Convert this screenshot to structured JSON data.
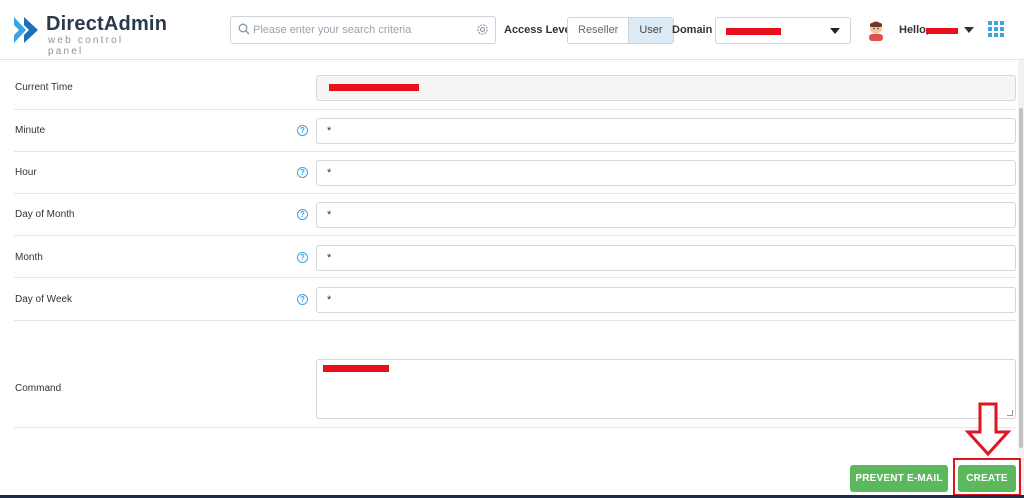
{
  "header": {
    "logo_title": "DirectAdmin",
    "logo_subtitle": "web control panel",
    "search_placeholder": "Please enter your search criteria",
    "access_level_label": "Access Level",
    "access_levels": [
      "Reseller",
      "User"
    ],
    "active_access_level": "User",
    "domain_label": "Domain",
    "domain_value": "",
    "greeting": "Hello,"
  },
  "form": {
    "current_time_label": "Current Time",
    "current_time_value": "",
    "fields": [
      {
        "label": "Minute",
        "value": "*"
      },
      {
        "label": "Hour",
        "value": "*"
      },
      {
        "label": "Day of Month",
        "value": "*"
      },
      {
        "label": "Month",
        "value": "*"
      },
      {
        "label": "Day of Week",
        "value": "*"
      }
    ],
    "command_label": "Command",
    "command_value": ""
  },
  "actions": {
    "prevent_email_label": "PREVENT E-MAIL",
    "create_label": "CREATE"
  },
  "colors": {
    "brand_blue": "#3ba4e0",
    "button_green": "#5cb85c",
    "highlight_red": "#e3141f",
    "redaction_red": "#e8101d"
  },
  "icons": {
    "search": "search-icon",
    "settings": "gear-icon",
    "help": "question-circle-icon",
    "apps": "grid-icon",
    "dropdown": "caret-down-icon",
    "annotation": "down-arrow-icon"
  }
}
